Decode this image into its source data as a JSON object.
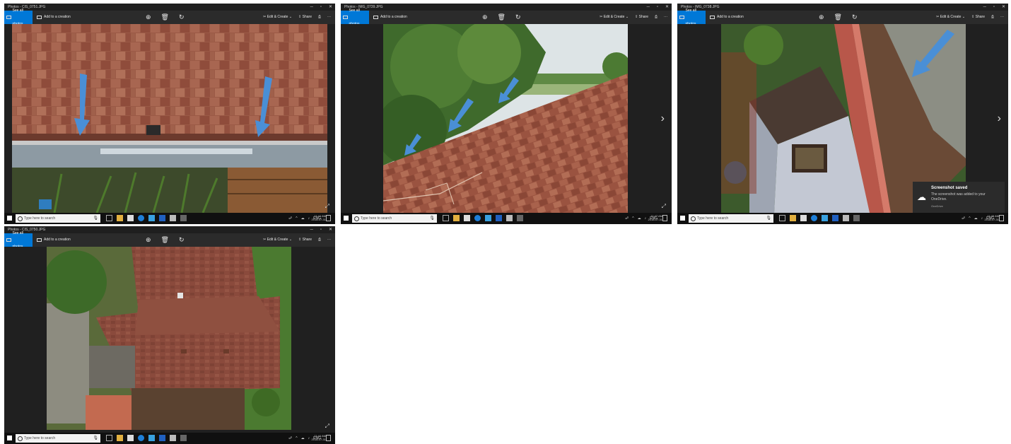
{
  "toolbar": {
    "see_all": "See all photos",
    "add_creation": "Add to a creation",
    "edit_create": "Edit & Create",
    "share": "Share"
  },
  "taskbar": {
    "search_placeholder": "Type here to search",
    "lang": "ENG"
  },
  "windows": [
    {
      "title": "Photos - CIS_0751.JPG",
      "time": "11:44 AM",
      "date": "2018-07-31"
    },
    {
      "title": "Photos - IMG_0739.JPG",
      "time": "11:47 AM",
      "date": "2018-07-31"
    },
    {
      "title": "Photos - IMG_0738.JPG",
      "time": "11:49 AM",
      "date": "2018-07-31"
    },
    {
      "title": "Photos - CIS_0750.JPG",
      "time": "11:44 AM",
      "date": "2018-07-31"
    }
  ],
  "toast": {
    "title": "Screenshot saved",
    "body": "The screenshot was added to your OneDrive.",
    "source": "OneDrive"
  },
  "colors": {
    "accent": "#0078d7",
    "arrow": "#4a8fd6",
    "shingle": "#8a4a3c"
  }
}
